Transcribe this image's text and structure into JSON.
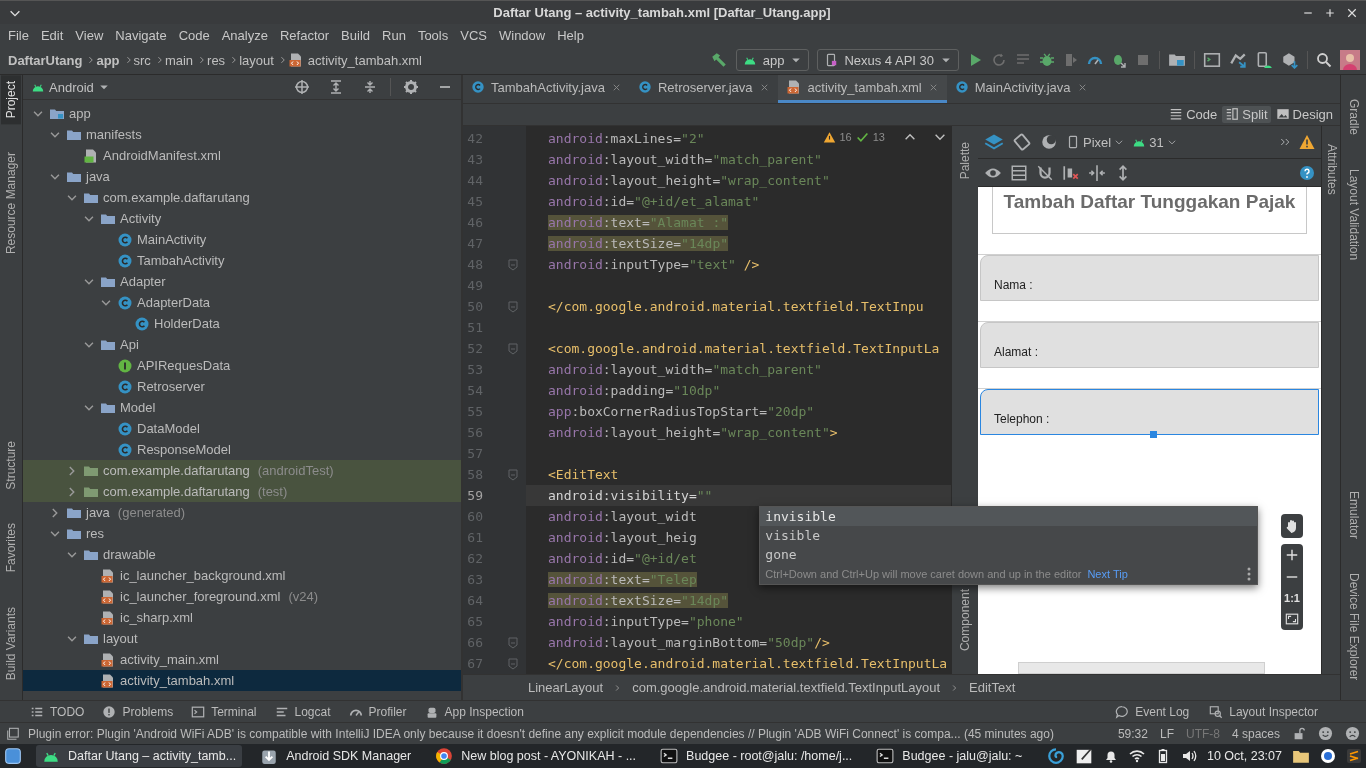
{
  "window": {
    "title": "Daftar Utang – activity_tambah.xml [Daftar_Utang.app]"
  },
  "menu": [
    "File",
    "Edit",
    "View",
    "Navigate",
    "Code",
    "Analyze",
    "Refactor",
    "Build",
    "Run",
    "Tools",
    "VCS",
    "Window",
    "Help"
  ],
  "breadcrumbs": [
    {
      "label": "DaftarUtang",
      "bold": true,
      "kind": "folder"
    },
    {
      "label": "app",
      "bold": true,
      "kind": "folder"
    },
    {
      "label": "src",
      "bold": false,
      "kind": "folder"
    },
    {
      "label": "main",
      "bold": false,
      "kind": "folder"
    },
    {
      "label": "res",
      "bold": false,
      "kind": "folder"
    },
    {
      "label": "layout",
      "bold": false,
      "kind": "folder"
    },
    {
      "label": "activity_tambah.xml",
      "bold": false,
      "kind": "xml"
    }
  ],
  "toolbar": {
    "run_config": "app",
    "device": "Nexus 4 API 30"
  },
  "left_stripe": [
    {
      "label": "Project",
      "selected": true
    },
    {
      "label": "Resource Manager",
      "selected": false
    },
    {
      "label": "Structure",
      "selected": false
    },
    {
      "label": "Favorites",
      "selected": false
    },
    {
      "label": "Build Variants",
      "selected": false
    }
  ],
  "project": {
    "view": "Android",
    "tree": [
      {
        "label": "app",
        "kind": "module",
        "expanded": true,
        "selected": false,
        "children": [
          {
            "label": "manifests",
            "kind": "folder",
            "expanded": true,
            "selected": false,
            "children": [
              {
                "label": "AndroidManifest.xml",
                "kind": "manifest",
                "selected": false
              }
            ]
          },
          {
            "label": "java",
            "kind": "folder",
            "expanded": true,
            "selected": false,
            "children": [
              {
                "label": "com.example.daftarutang",
                "kind": "package",
                "expanded": true,
                "selected": false,
                "children": [
                  {
                    "label": "Activity",
                    "kind": "package",
                    "expanded": true,
                    "selected": false,
                    "children": [
                      {
                        "label": "MainActivity",
                        "kind": "class",
                        "selected": false
                      },
                      {
                        "label": "TambahActivity",
                        "kind": "class",
                        "selected": false
                      }
                    ]
                  },
                  {
                    "label": "Adapter",
                    "kind": "package",
                    "expanded": true,
                    "selected": false,
                    "children": [
                      {
                        "label": "AdapterData",
                        "kind": "class",
                        "expanded": true,
                        "selected": false,
                        "children": [
                          {
                            "label": "HolderData",
                            "kind": "class",
                            "selected": false
                          }
                        ]
                      }
                    ]
                  },
                  {
                    "label": "Api",
                    "kind": "package",
                    "expanded": true,
                    "selected": false,
                    "children": [
                      {
                        "label": "APIRequesData",
                        "kind": "interface",
                        "selected": false
                      },
                      {
                        "label": "Retroserver",
                        "kind": "class",
                        "selected": false
                      }
                    ]
                  },
                  {
                    "label": "Model",
                    "kind": "package",
                    "expanded": true,
                    "selected": false,
                    "children": [
                      {
                        "label": "DataModel",
                        "kind": "class",
                        "selected": false
                      },
                      {
                        "label": "ResponseModel",
                        "kind": "class",
                        "selected": false
                      }
                    ]
                  }
                ]
              },
              {
                "label": "com.example.daftarutang",
                "suffix": "(androidTest)",
                "kind": "test_package",
                "expanded": false,
                "selected": false
              },
              {
                "label": "com.example.daftarutang",
                "suffix": "(test)",
                "kind": "test_package",
                "expanded": false,
                "selected": false
              }
            ]
          },
          {
            "label": "java",
            "suffix": "(generated)",
            "kind": "folder",
            "expanded": false,
            "selected": false
          },
          {
            "label": "res",
            "kind": "folder",
            "expanded": true,
            "selected": false,
            "children": [
              {
                "label": "drawable",
                "kind": "folder",
                "expanded": true,
                "selected": false,
                "children": [
                  {
                    "label": "ic_launcher_background.xml",
                    "kind": "xml",
                    "selected": false
                  },
                  {
                    "label": "ic_launcher_foreground.xml",
                    "suffix": "(v24)",
                    "kind": "xml",
                    "selected": false
                  },
                  {
                    "label": "ic_sharp.xml",
                    "kind": "xml",
                    "selected": false
                  }
                ]
              },
              {
                "label": "layout",
                "kind": "folder",
                "expanded": true,
                "selected": false,
                "children": [
                  {
                    "label": "activity_main.xml",
                    "kind": "xml",
                    "selected": false
                  },
                  {
                    "label": "activity_tambah.xml",
                    "kind": "xml",
                    "selected": true
                  }
                ]
              }
            ]
          }
        ]
      }
    ]
  },
  "editor": {
    "tabs": [
      {
        "label": "TambahActivity.java",
        "kind": "class",
        "selected": false
      },
      {
        "label": "Retroserver.java",
        "kind": "class",
        "selected": false
      },
      {
        "label": "activity_tambah.xml",
        "kind": "xml",
        "selected": true
      },
      {
        "label": "MainActivity.java",
        "kind": "class",
        "selected": false
      }
    ],
    "view_modes": [
      {
        "label": "Code",
        "kind": "code",
        "selected": false
      },
      {
        "label": "Split",
        "kind": "split",
        "selected": true
      },
      {
        "label": "Design",
        "kind": "design",
        "selected": false
      }
    ],
    "problems": {
      "warnings": "16",
      "weak_warnings": "13"
    },
    "lines": [
      {
        "number": "42",
        "text": "         android:maxLines=\"2\"",
        "highlighted": false,
        "current": false
      },
      {
        "number": "43",
        "text": "         android:layout_width=\"match_parent\"",
        "highlighted": false,
        "current": false
      },
      {
        "number": "44",
        "text": "         android:layout_height=\"wrap_content\"",
        "highlighted": false,
        "current": false
      },
      {
        "number": "45",
        "text": "         android:id=\"@+id/et_alamat\"",
        "highlighted": false,
        "current": false
      },
      {
        "number": "46",
        "text": "         android:text=\"Alamat :\"",
        "highlighted": true,
        "current": false
      },
      {
        "number": "47",
        "text": "         android:textSize=\"14dp\"",
        "highlighted": true,
        "current": false
      },
      {
        "number": "48",
        "text": "         android:inputType=\"text\" />",
        "highlighted": false,
        "current": false
      },
      {
        "number": "49",
        "current": false
      },
      {
        "number": "50",
        "text": " </com.google.android.material.textfield.TextInpu",
        "highlighted": false,
        "current": false
      },
      {
        "number": "51",
        "current": false
      },
      {
        "number": "52",
        "text": "<com.google.android.material.textfield.TextInputLa",
        "highlighted": false,
        "current": false
      },
      {
        "number": "53",
        "text": "    android:layout_width=\"match_parent\"",
        "highlighted": false,
        "current": false
      },
      {
        "number": "54",
        "text": "    android:padding=\"10dp\"",
        "highlighted": false,
        "current": false
      },
      {
        "number": "55",
        "text": "    app:boxCornerRadiusTopStart=\"20dp\"",
        "highlighted": false,
        "current": false
      },
      {
        "number": "56",
        "text": "    android:layout_height=\"wrap_content\">",
        "highlighted": false,
        "current": false
      },
      {
        "number": "57",
        "current": false
      },
      {
        "number": "58",
        "text": "    <EditText",
        "highlighted": false,
        "current": false
      },
      {
        "number": "59",
        "text": "        android:visibility=\"\"",
        "highlighted": false,
        "current": true
      },
      {
        "number": "60",
        "text": "        android:layout_widt",
        "highlighted": false,
        "current": false
      },
      {
        "number": "61",
        "text": "        android:layout_heig",
        "highlighted": false,
        "current": false
      },
      {
        "number": "62",
        "text": "        android:id=\"@+id/et",
        "highlighted": false,
        "current": false
      },
      {
        "number": "63",
        "text": "        android:text=\"Telep",
        "highlighted": true,
        "current": false
      },
      {
        "number": "64",
        "text": "        android:textSize=\"14dp\"",
        "highlighted": true,
        "current": false
      },
      {
        "number": "65",
        "text": "        android:inputType=\"phone\"",
        "highlighted": false,
        "current": false
      },
      {
        "number": "66",
        "text": "        android:layout_marginBottom=\"50dp\"/>",
        "highlighted": false,
        "current": false
      },
      {
        "number": "67",
        "text": "</com.google.android.material.textfield.TextInputLa",
        "highlighted": false,
        "current": false
      }
    ],
    "completion": {
      "items": [
        {
          "label": "invisible",
          "selected": true
        },
        {
          "label": "visible",
          "selected": false
        },
        {
          "label": "gone",
          "selected": false
        }
      ],
      "hint": "Ctrl+Down and Ctrl+Up will move caret down and up in the editor",
      "link": "Next Tip"
    },
    "breadcrumbs": [
      "LinearLayout",
      "com.google.android.material.textfield.TextInputLayout",
      "EditText"
    ]
  },
  "design": {
    "palette_label": "Palette",
    "component_label": "Component",
    "attributes_label": "Attributes",
    "device": "Pixel",
    "api": "31",
    "title": "Tambah Daftar Tunggakan Pajak",
    "fields": [
      {
        "label": "Nama :",
        "selected": false
      },
      {
        "label": "Alamat :",
        "selected": false
      },
      {
        "label": "Telephon :",
        "selected": true
      }
    ],
    "zoom_reset": "1:1"
  },
  "right_stripe": [
    "Gradle",
    "Layout Validation",
    "Emulator",
    "Device File Explorer"
  ],
  "tool_windows": {
    "left": [
      {
        "label": "TODO",
        "kind": "list"
      },
      {
        "label": "Problems",
        "kind": "problems"
      },
      {
        "label": "Terminal",
        "kind": "terminal"
      },
      {
        "label": "Logcat",
        "kind": "logcat"
      },
      {
        "label": "Profiler",
        "kind": "profiler"
      },
      {
        "label": "App Inspection",
        "kind": "inspection"
      }
    ],
    "right": [
      {
        "label": "Event Log",
        "kind": "event"
      },
      {
        "label": "Layout Inspector",
        "kind": "inspector"
      }
    ]
  },
  "status": {
    "message": "Plugin error: Plugin 'Android WiFi ADB' is compatible with IntelliJ IDEA only because it doesn't define any explicit module dependencies // Plugin 'ADB WiFi Connect' is compa... (45 minutes ago)",
    "position": "59:32",
    "line_ending": "LF",
    "encoding": "UTF-8",
    "indent": "4 spaces"
  },
  "taskbar": {
    "windows": [
      {
        "title": "Daftar Utang – activity_tamb...",
        "kind": "android",
        "selected": true
      },
      {
        "title": "Android SDK Manager",
        "kind": "download",
        "selected": false
      },
      {
        "title": "New blog post - AYONIKAH - ...",
        "kind": "browser",
        "selected": false
      },
      {
        "title": "Budgee - root@jalu: /home/j...",
        "kind": "terminal",
        "selected": false
      },
      {
        "title": "Budgee - jalu@jalu: ~",
        "kind": "terminal",
        "selected": false
      }
    ],
    "clock": "10 Oct, 23:07"
  }
}
